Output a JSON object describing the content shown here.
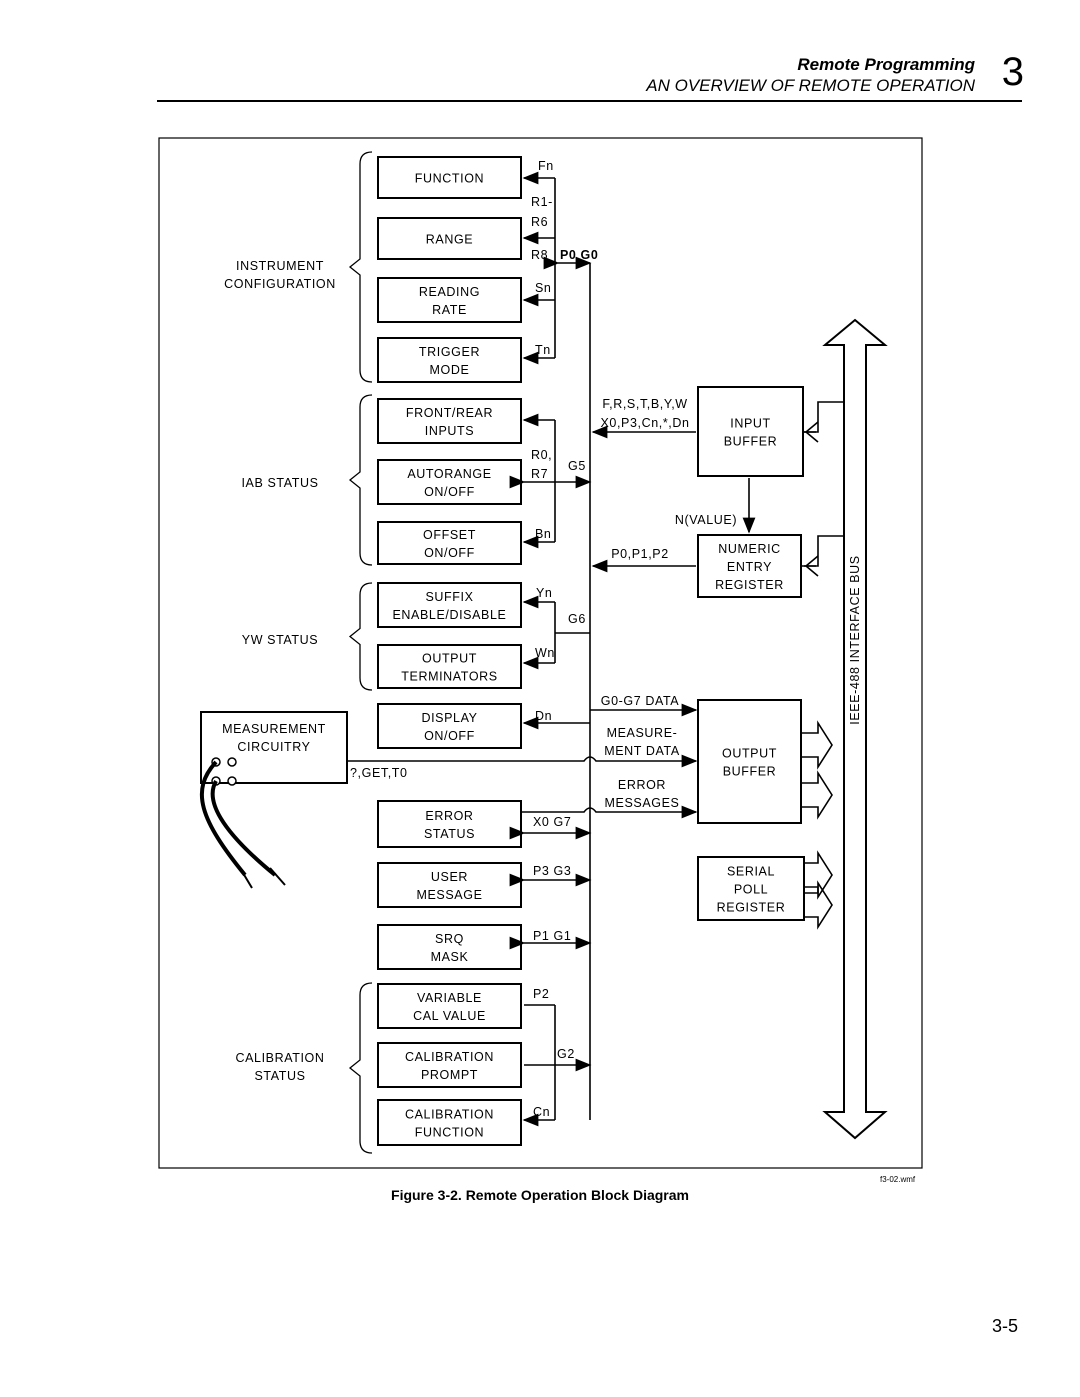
{
  "header": {
    "section": "Remote Programming",
    "subsection": "AN OVERVIEW OF REMOTE OPERATION",
    "chapter": "3"
  },
  "diagram": {
    "groups": [
      {
        "lines": [
          "INSTRUMENT",
          "CONFIGURATION"
        ]
      },
      {
        "lines": [
          "IAB STATUS"
        ]
      },
      {
        "lines": [
          "YW STATUS"
        ]
      },
      {
        "lines": [
          "CALIBRATION",
          "STATUS"
        ]
      }
    ],
    "blocks": [
      {
        "lines": [
          "FUNCTION"
        ],
        "cmd": "Fn"
      },
      {
        "lines": [
          "RANGE"
        ],
        "cmd": "R1- R6 R8"
      },
      {
        "lines": [
          "READING",
          "RATE"
        ],
        "cmd": "Sn"
      },
      {
        "lines": [
          "TRIGGER",
          "MODE"
        ],
        "cmd": "Tn"
      },
      {
        "lines": [
          "FRONT/REAR",
          "INPUTS"
        ],
        "cmd": ""
      },
      {
        "lines": [
          "AUTORANGE",
          "ON/OFF"
        ],
        "cmd": "R0, R7"
      },
      {
        "lines": [
          "OFFSET",
          "ON/OFF"
        ],
        "cmd": "Bn"
      },
      {
        "lines": [
          "SUFFIX",
          "ENABLE/DISABLE"
        ],
        "cmd": "Yn"
      },
      {
        "lines": [
          "OUTPUT",
          "TERMINATORS"
        ],
        "cmd": "Wn"
      },
      {
        "lines": [
          "DISPLAY",
          "ON/OFF"
        ],
        "cmd": "Dn"
      },
      {
        "lines": [
          "ERROR",
          "STATUS"
        ],
        "cmd": "X0  G7"
      },
      {
        "lines": [
          "USER",
          "MESSAGE"
        ],
        "cmd": "P3  G3"
      },
      {
        "lines": [
          "SRQ",
          "MASK"
        ],
        "cmd": "P1  G1"
      },
      {
        "lines": [
          "VARIABLE",
          "CAL VALUE"
        ],
        "cmd": "P2"
      },
      {
        "lines": [
          "CALIBRATION",
          "PROMPT"
        ],
        "cmd": "G2"
      },
      {
        "lines": [
          "CALIBRATION",
          "FUNCTION"
        ],
        "cmd": "Cn"
      }
    ],
    "bus_labels": {
      "p0g0": "P0 G0",
      "g5": "G5",
      "g6": "G6"
    },
    "right_blocks": {
      "input_buffer": [
        "INPUT",
        "BUFFER"
      ],
      "numeric_entry": [
        "NUMERIC",
        "ENTRY",
        "REGISTER"
      ],
      "output_buffer": [
        "OUTPUT",
        "BUFFER"
      ],
      "serial_poll": [
        "SERIAL",
        "POLL",
        "REGISTER"
      ]
    },
    "signals": {
      "input_cmds_1": "F,R,S,T,B,Y,W",
      "input_cmds_2": "X0,P3,Cn,*,Dn",
      "n_value": "N(VALUE)",
      "p012": "P0,P1,P2",
      "g0g7": "G0-G7 DATA",
      "meas_1": "MEASURE-",
      "meas_2": "MENT DATA",
      "err_1": "ERROR",
      "err_2": "MESSAGES",
      "get": "?,GET,T0"
    },
    "measurement": [
      "MEASUREMENT",
      "CIRCUITRY"
    ],
    "bus_name": "IEEE-488 INTERFACE BUS"
  },
  "figure": {
    "filename": "f3-02.wmf",
    "caption": "Figure 3-2. Remote Operation Block Diagram"
  },
  "page_number": "3-5"
}
